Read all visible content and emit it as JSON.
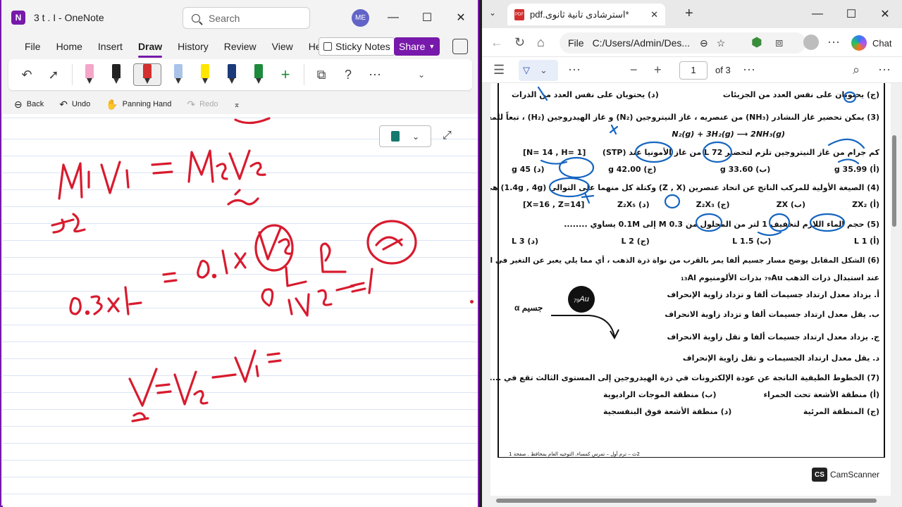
{
  "onenote": {
    "title": "3 t . I - OneNote",
    "logo": "N",
    "search_placeholder": "Search",
    "avatar": "ME",
    "menu": [
      "File",
      "Home",
      "Insert",
      "Draw",
      "History",
      "Review",
      "View",
      "Help"
    ],
    "active_menu": "Draw",
    "sticky_notes": "Sticky Notes",
    "share": "Share",
    "quick": {
      "back": "Back",
      "undo": "Undo",
      "panning": "Panning Hand",
      "redo": "Redo"
    },
    "pen_colors": [
      "#f4a6c8",
      "#222222",
      "#d32f2f",
      "#a9c4e8",
      "#ffe600",
      "#1b3a7a",
      "#1e8a3c"
    ],
    "ink_color": "#d81b2e"
  },
  "edge": {
    "tab_title": "*استرشادى تانية ثانوى.pdf",
    "address_prefix": "File",
    "address": "C:/Users/Admin/Des...",
    "chat": "Chat",
    "page_number": "1",
    "page_of": "of 3",
    "pdf_icon": "PDF"
  },
  "pdf": {
    "line_0": "(ج) يحتويان على نفس العدد من الجزيئات",
    "line_0b": "(د) يحتويان على نفس العدد من الذرات",
    "q3": "(3) يمكن تحضير غاز النشادر (NH₃) من عنصريه ، غاز النيتروجين (N₂) و غاز الهيدروجين (H₂) ، تبعاً للمعادلة التالية",
    "q3_eq": "N₂(g) + 3H₂(g) ⟶ 2NH₃(g)",
    "q3_b": "كم جرام من غاز النيتروجين تلزم لتحضير 72 L من غاز الأمونيا عند (STP)",
    "q3_given": "[N= 14 , H= 1]",
    "q3_opts": [
      "(أ) 35.99 g",
      "(ب) 33.60 g",
      "(ج) 42.00 g",
      "(د) 45 g"
    ],
    "q4": "(4) الصيغة الأولية للمركب الناتج عن اتحاد عنصرين (Z , X) وكتلة كل منهما على التوالي (1.4g , 4g) هي .....",
    "q4_given": "[X=16 , Z=14]",
    "q4_opts": [
      "(أ) ZX₂",
      "(ب) ZX",
      "(ج) Z₂X₃",
      "(د) Z₂X₅"
    ],
    "q5": "(5) حجم الماء اللازم لتخفيف 1 لتر من المحلول من 0.3 M إلى 0.1M يساوي ........",
    "q5_opts": [
      "(أ) 1 L",
      "(ب) 1.5 L",
      "(ج) 2 L",
      "(د) 3 L"
    ],
    "q6": "(6) الشكل المقابل يوضح مسار جسيم ألفا يمر بالقرب من نواة ذرة الذهب ، أي مما يلي يعبر عن التغير في المشاهدات",
    "q6_b": "عند استبدال ذرات الذهب ₇₉Au بذرات الألومنيوم ₁₃Al",
    "q6_opts": [
      "أ. يزداد معدل ارتداد جسيمات ألفا و تزداد زاوية الإنحراف",
      "ب. يقل معدل ارتداد جسيمات ألفا و تزداد زاوية الانحراف",
      "ج. يزداد معدل ارتداد جسيمات ألفا و تقل زاوية الانحراف",
      "د. يقل معدل ارتداد الجسيمات و تقل زاوية الإنحراف"
    ],
    "atom": "₇₉Au",
    "alpha": "α جسيم",
    "q7": "(7) الخطوط الطيفية الناتجة عن عودة الإلكترونات في ذرة الهيدروجين إلى المستوى الثالث تقع في ........",
    "q7_opts_1": [
      "(أ) منطقة الأشعة تحت الحمراء",
      "(ب) منطقة الموجات الراديوية"
    ],
    "q7_opts_2": [
      "(ج) المنطقة المرئية",
      "(د) منطقة الأشعة فوق البنفسجية"
    ],
    "footer": "2ث – ترم أول – تمرس كمساء. التوجيه العام بمحافظ . صفحة 1",
    "camscanner": "CamScanner",
    "cs": "CS"
  }
}
